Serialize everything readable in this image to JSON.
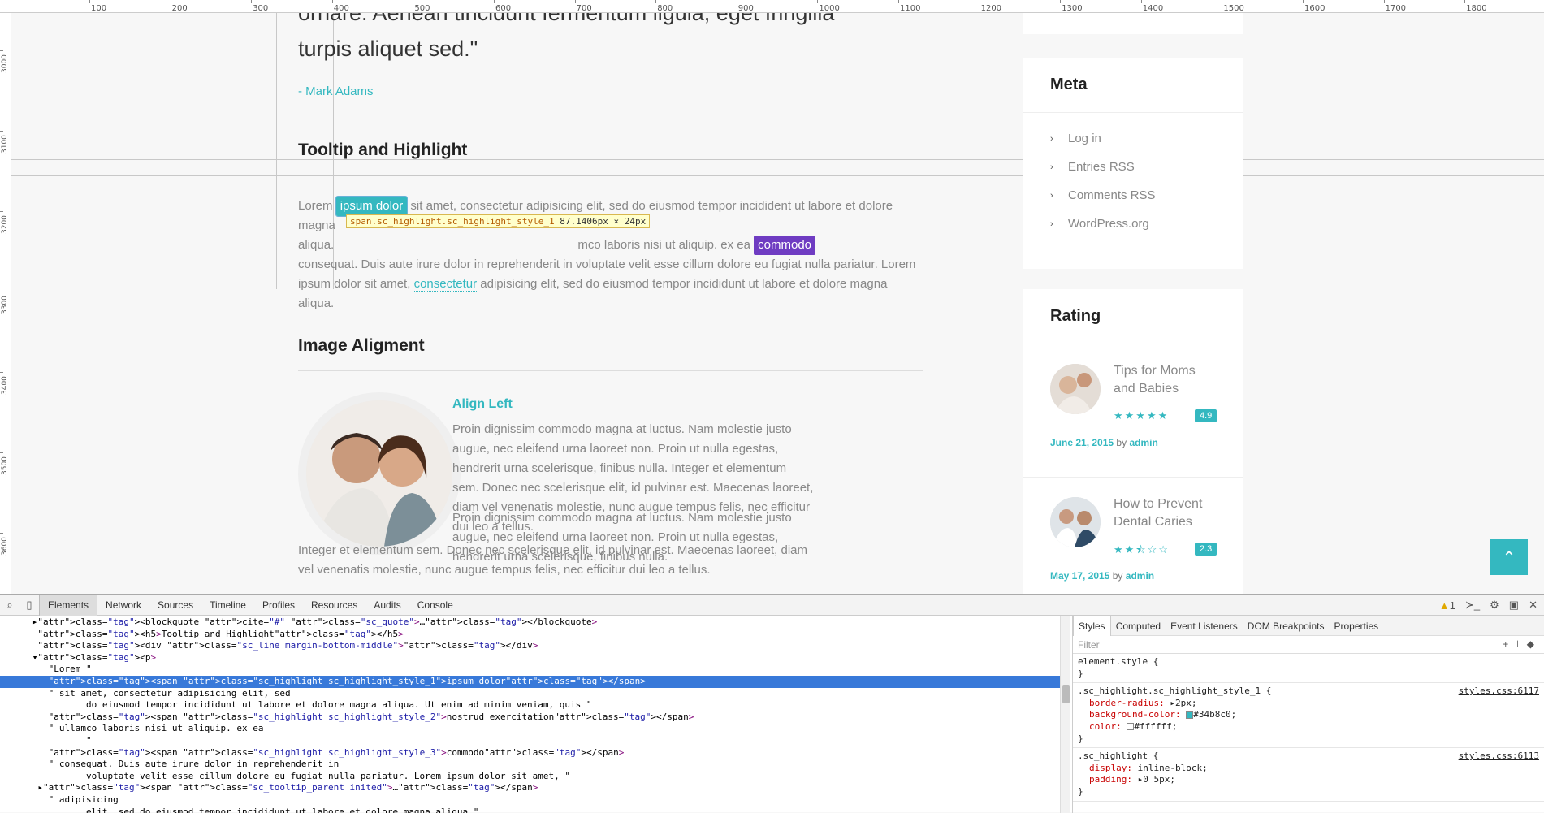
{
  "ruler": {
    "top_labels": [
      "100",
      "200",
      "300",
      "400",
      "500",
      "600",
      "700",
      "800",
      "900",
      "1000",
      "1100",
      "1200",
      "1300",
      "1400",
      "1500",
      "1600",
      "1700",
      "1800"
    ],
    "left_labels": [
      "3000",
      "3100",
      "3200",
      "3300",
      "3400",
      "3500",
      "3600"
    ]
  },
  "content": {
    "quote_line1": "ornare. Aenean tincidunt fermentum ligula, eget fringilla",
    "quote_line2": "turpis aliquet sed.\"",
    "quote_author": "- Mark Adams",
    "tooltip_section_title": "Tooltip and Highlight",
    "para1": {
      "lorem": "Lorem",
      "highlight1": "ipsum dolor",
      "after1": " sit amet, consectetur adipisicing elit, sed do eiusmod tempor incidident ut labore et dolore magna",
      "line2_start": "aliqua. ",
      "line2_mid": "mco laboris nisi ut aliquip. ex ea ",
      "highlight3": "commodo",
      "line3": "consequat. Duis aute irure dolor in reprehenderit in voluptate velit esse cillum dolore eu fugiat nulla pariatur. Lorem",
      "line4_start": "ipsum dolor sit amet, ",
      "tooltip_link": "consectetur",
      "line4_end": " adipisicing elit, sed do eiusmod tempor incididunt ut labore et dolore magna aliqua."
    },
    "inspect_badge_selector": "span.sc_highlight.sc_highlight_style_1",
    "inspect_badge_dims": "87.1406px × 24px",
    "image_section_title": "Image Aligment",
    "align_left_title": "Align Left",
    "align_para1": "Proin dignissim commodo magna at luctus. Nam molestie justo augue, nec eleifend urna laoreet non. Proin ut nulla egestas, hendrerit urna scelerisque, finibus nulla. Integer et elementum sem. Donec nec scelerisque elit, id pulvinar est. Maecenas laoreet, diam vel venenatis molestie, nunc augue tempus felis, nec efficitur dui leo a tellus.",
    "align_para2_a": "Proin dignissim commodo magna at luctus. Nam molestie justo augue, nec eleifend urna laoreet non. Proin ut nulla egestas, hendrerit urna scelerisque, finibus nulla.",
    "align_para2_b": "Integer et elementum sem. Donec nec scelerisque elit, id pulvinar est. Maecenas laoreet, diam vel venenatis molestie, nunc augue tempus felis, nec efficitur dui leo a tellus."
  },
  "sidebar": {
    "meta_title": "Meta",
    "meta_items": [
      "Log in",
      "Entries RSS",
      "Comments RSS",
      "WordPress.org"
    ],
    "rating_title": "Rating",
    "ratings": [
      {
        "title": "Tips for Moms and Babies",
        "stars": "★★★★★",
        "score": "4.9",
        "date": "June 21, 2015",
        "by": "by",
        "author": "admin",
        "rating_value": 4.9
      },
      {
        "title": "How to Prevent Dental Caries",
        "stars": "★★⯪☆☆",
        "score": "2.3",
        "date": "May 17, 2015",
        "by": "by",
        "author": "admin",
        "rating_value": 2.3
      }
    ]
  },
  "back_to_top_icon": "chevron-up-icon",
  "devtools": {
    "tabs": [
      "Elements",
      "Network",
      "Sources",
      "Timeline",
      "Profiles",
      "Resources",
      "Audits",
      "Console"
    ],
    "warning_count": "1",
    "dom_lines": [
      "      ▸<blockquote cite=\"#\" class=\"sc_quote\">…</blockquote>",
      "       <h5>Tooltip and Highlight</h5>",
      "       <div class=\"sc_line margin-bottom-middle\"></div>",
      "      ▾<p>",
      "         \"Lorem \"",
      "         <span class=\"sc_highlight sc_highlight_style_1\">ipsum dolor</span>",
      "         \" sit amet, consectetur adipisicing elit, sed",
      "                do eiusmod tempor incididunt ut labore et dolore magna aliqua. Ut enim ad minim veniam, quis \"",
      "         <span class=\"sc_highlight sc_highlight_style_2\">nostrud exercitation</span>",
      "         \" ullamco laboris nisi ut aliquip. ex ea",
      "                \"",
      "         <span class=\"sc_highlight sc_highlight_style_3\">commodo</span>",
      "         \" consequat. Duis aute irure dolor in reprehenderit in",
      "                voluptate velit esse cillum dolore eu fugiat nulla pariatur. Lorem ipsum dolor sit amet, \"",
      "       ▸<span class=\"sc_tooltip_parent inited\">…</span>",
      "         \" adipisicing",
      "                elit, sed do eiusmod tempor incididunt ut labore et dolore magna aliqua.\""
    ],
    "selected_line_index": 5,
    "styles_tabs": [
      "Styles",
      "Computed",
      "Event Listeners",
      "DOM Breakpoints",
      "Properties"
    ],
    "filter_placeholder": "Filter",
    "rules": [
      {
        "selector": "element.style {",
        "props": [],
        "source": ""
      },
      {
        "selector": ".sc_highlight.sc_highlight_style_1 {",
        "props": [
          {
            "name": "border-radius:",
            "value": "▸2px;"
          },
          {
            "name": "background-color:",
            "value": "#34b8c0;",
            "swatch": "#34b8c0"
          },
          {
            "name": "color:",
            "value": "#ffffff;",
            "swatch": "#ffffff"
          }
        ],
        "source": "styles.css:6117"
      },
      {
        "selector": ".sc_highlight {",
        "props": [
          {
            "name": "display:",
            "value": "inline-block;"
          },
          {
            "name": "padding:",
            "value": "▸0 5px;"
          }
        ],
        "source": "styles.css:6113"
      }
    ]
  }
}
